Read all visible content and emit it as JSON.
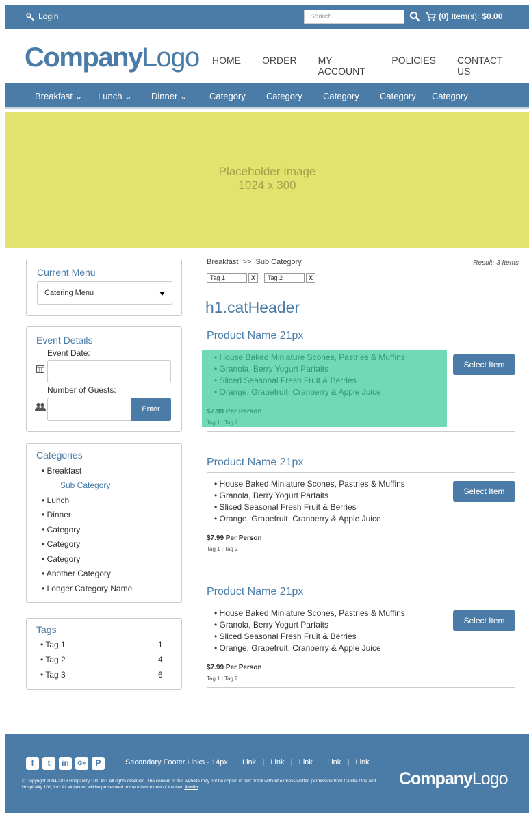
{
  "topbar": {
    "login": "Login",
    "search_placeholder": "Search",
    "cart_count": "(0)",
    "cart_label": "Item(s):",
    "cart_total": "$0.00"
  },
  "header": {
    "logo_bold": "Company",
    "logo_light": "Logo",
    "nav": [
      "HOME",
      "ORDER",
      "MY ACCOUNT",
      "POLICIES",
      "CONTACT US"
    ]
  },
  "catnav": [
    "Breakfast ⌄",
    "Lunch ⌄",
    "Dinner ⌄",
    "Category",
    "Category",
    "Category",
    "Category",
    "Category"
  ],
  "hero": {
    "line1": "Placeholder Image",
    "line2": "1024 x 300"
  },
  "current_menu": {
    "title": "Current Menu",
    "selected": "Catering Menu"
  },
  "event": {
    "title": "Event Details",
    "date_label": "Event Date:",
    "guests_label": "Number of Guests:",
    "enter": "Enter"
  },
  "categories": {
    "title": "Categories",
    "items": [
      "• Breakfast",
      "Sub Category",
      "• Lunch",
      "• Dinner",
      "• Category",
      "• Category",
      "• Category",
      "• Another Category",
      "• Longer Category Name"
    ]
  },
  "tags": {
    "title": "Tags",
    "items": [
      {
        "name": "• Tag 1",
        "count": "1"
      },
      {
        "name": "• Tag 2",
        "count": "4"
      },
      {
        "name": "• Tag 3",
        "count": "6"
      }
    ]
  },
  "main": {
    "breadcrumb": "Breakfast  >>  Sub Category",
    "result": "Result: 3 Items",
    "filter_tags": [
      "Tag 1",
      "Tag 2"
    ],
    "remove": "X",
    "cat_header": "h1.catHeader"
  },
  "products": [
    {
      "name": "Product Name 21px",
      "items": [
        "• House Baked Miniature Scones, Pastries & Muffins",
        "• Granola, Berry Yogurt Parfaits",
        "• Sliced Seasonal Fresh Fruit & Berries",
        "• Orange, Grapefruit, Cranberry & Apple Juice"
      ],
      "price": "$7.99 Per Person",
      "tags": "Tag 1 | Tag 2",
      "button": "Select Item"
    },
    {
      "name": "Product Name 21px",
      "items": [
        "• House Baked Miniature Scones, Pastries & Muffins",
        "• Granola, Berry Yogurt Parfaits",
        "• Sliced Seasonal Fresh Fruit & Berries",
        "• Orange, Grapefruit, Cranberry & Apple Juice"
      ],
      "price": "$7.99 Per Person",
      "tags": "Tag 1 | Tag 2",
      "button": "Select Item"
    },
    {
      "name": "Product Name 21px",
      "items": [
        "• House Baked Miniature Scones, Pastries & Muffins",
        "• Granola, Berry Yogurt Parfaits",
        "• Sliced Seasonal Fresh Fruit & Berries",
        "• Orange, Grapefruit, Cranberry & Apple Juice"
      ],
      "price": "$7.99 Per Person",
      "tags": "Tag 1 | Tag 2",
      "button": "Select Item"
    }
  ],
  "footer": {
    "social": [
      "f",
      "t",
      "in",
      "G+",
      "P"
    ],
    "links": "Secondary Footer Links - 14px   |   Link   |   Link   |   Link   |   Link   |   Link",
    "copyright": "© Copyright 2004-2016 Hospitality 101, Inc. All rights reserved. The content of this website may not be copied in part or full without express written permission from Capital One and Hospitality 101, Inc. All violations will be prosecuted to the fullest extent of the law.",
    "admin": "Admin",
    "logo_bold": "Company",
    "logo_light": "Logo"
  },
  "colors": {
    "brand": "#4a7ca7",
    "hero": "#e3e26f",
    "highlight": "#72d9b6"
  }
}
